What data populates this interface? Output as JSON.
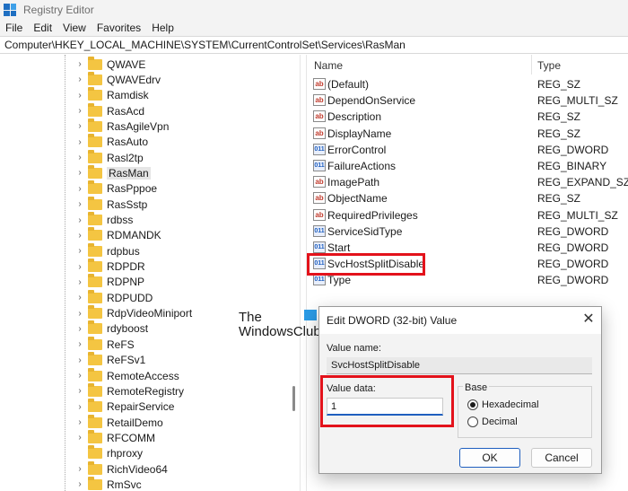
{
  "window": {
    "title": "Registry Editor"
  },
  "menu": [
    "File",
    "Edit",
    "View",
    "Favorites",
    "Help"
  ],
  "address": "Computer\\HKEY_LOCAL_MACHINE\\SYSTEM\\CurrentControlSet\\Services\\RasMan",
  "tree": {
    "selected": "RasMan",
    "items": [
      {
        "label": "QWAVE",
        "expandable": true
      },
      {
        "label": "QWAVEdrv",
        "expandable": true
      },
      {
        "label": "Ramdisk",
        "expandable": true
      },
      {
        "label": "RasAcd",
        "expandable": true
      },
      {
        "label": "RasAgileVpn",
        "expandable": true
      },
      {
        "label": "RasAuto",
        "expandable": true
      },
      {
        "label": "Rasl2tp",
        "expandable": true
      },
      {
        "label": "RasMan",
        "expandable": true
      },
      {
        "label": "RasPppoe",
        "expandable": true
      },
      {
        "label": "RasSstp",
        "expandable": true
      },
      {
        "label": "rdbss",
        "expandable": true
      },
      {
        "label": "RDMANDK",
        "expandable": true
      },
      {
        "label": "rdpbus",
        "expandable": true
      },
      {
        "label": "RDPDR",
        "expandable": true
      },
      {
        "label": "RDPNP",
        "expandable": true
      },
      {
        "label": "RDPUDD",
        "expandable": true
      },
      {
        "label": "RdpVideoMiniport",
        "expandable": true
      },
      {
        "label": "rdyboost",
        "expandable": true
      },
      {
        "label": "ReFS",
        "expandable": true
      },
      {
        "label": "ReFSv1",
        "expandable": true
      },
      {
        "label": "RemoteAccess",
        "expandable": true
      },
      {
        "label": "RemoteRegistry",
        "expandable": true
      },
      {
        "label": "RepairService",
        "expandable": true
      },
      {
        "label": "RetailDemo",
        "expandable": true
      },
      {
        "label": "RFCOMM",
        "expandable": true
      },
      {
        "label": "rhproxy",
        "expandable": false
      },
      {
        "label": "RichVideo64",
        "expandable": true
      },
      {
        "label": "RmSvc",
        "expandable": true
      }
    ]
  },
  "list": {
    "headers": {
      "name": "Name",
      "type": "Type"
    },
    "rows": [
      {
        "name": "(Default)",
        "type": "REG_SZ",
        "icon": "string-value-icon"
      },
      {
        "name": "DependOnService",
        "type": "REG_MULTI_SZ",
        "icon": "string-value-icon"
      },
      {
        "name": "Description",
        "type": "REG_SZ",
        "icon": "string-value-icon"
      },
      {
        "name": "DisplayName",
        "type": "REG_SZ",
        "icon": "string-value-icon"
      },
      {
        "name": "ErrorControl",
        "type": "REG_DWORD",
        "icon": "binary-value-icon"
      },
      {
        "name": "FailureActions",
        "type": "REG_BINARY",
        "icon": "binary-value-icon"
      },
      {
        "name": "ImagePath",
        "type": "REG_EXPAND_SZ",
        "icon": "string-value-icon"
      },
      {
        "name": "ObjectName",
        "type": "REG_SZ",
        "icon": "string-value-icon"
      },
      {
        "name": "RequiredPrivileges",
        "type": "REG_MULTI_SZ",
        "icon": "string-value-icon"
      },
      {
        "name": "ServiceSidType",
        "type": "REG_DWORD",
        "icon": "binary-value-icon"
      },
      {
        "name": "Start",
        "type": "REG_DWORD",
        "icon": "binary-value-icon"
      },
      {
        "name": "SvcHostSplitDisable",
        "type": "REG_DWORD",
        "icon": "binary-value-icon"
      },
      {
        "name": "Type",
        "type": "REG_DWORD",
        "icon": "binary-value-icon"
      }
    ]
  },
  "watermark": {
    "line1": "The",
    "line2": "WindowsClub"
  },
  "dialog": {
    "title": "Edit DWORD (32-bit) Value",
    "value_name_label": "Value name:",
    "value_name": "SvcHostSplitDisable",
    "value_data_label": "Value data:",
    "value_data": "1",
    "base_label": "Base",
    "hex_label": "Hexadecimal",
    "dec_label": "Decimal",
    "base_selected": "Hexadecimal",
    "ok_label": "OK",
    "cancel_label": "Cancel"
  },
  "colors": {
    "highlight": "#e3121b",
    "accent": "#1f5fbf",
    "folder": "#f4c542"
  }
}
